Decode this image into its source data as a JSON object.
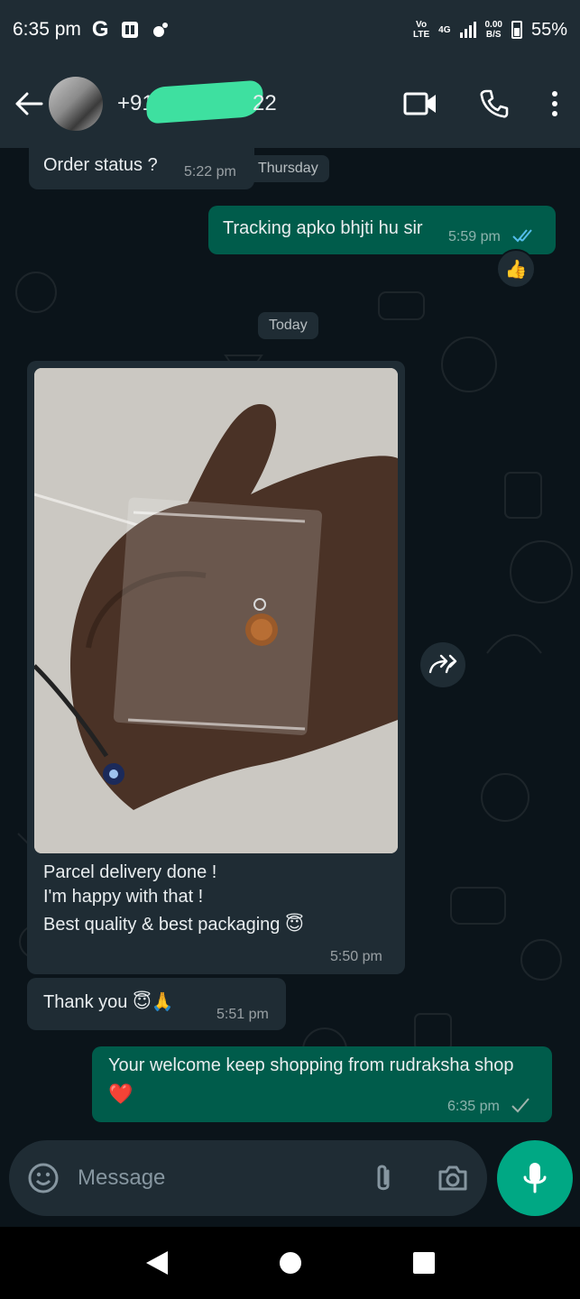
{
  "status_bar": {
    "time": "6:35 pm",
    "network_top": "Vo",
    "network_bottom": "LTE",
    "net_type": "4G",
    "speed_top": "0.00",
    "speed_bottom": "B/S",
    "battery": "55%"
  },
  "header": {
    "contact_prefix": "+91",
    "contact_suffix": "22",
    "icons": [
      "back-arrow-icon",
      "video-call-icon",
      "voice-call-icon",
      "more-options-icon"
    ]
  },
  "messages": [
    {
      "direction": "in",
      "text": "Order status ?",
      "time": "5:22 pm"
    },
    {
      "type": "date",
      "text": "Thursday"
    },
    {
      "direction": "out",
      "text": "Tracking apko bhjti hu sir",
      "time": "5:59 pm",
      "status": "read",
      "reaction": "👍"
    },
    {
      "type": "date",
      "text": "Today"
    },
    {
      "direction": "in",
      "type": "image",
      "line1": "Parcel delivery done !",
      "line2": "I'm happy with that !",
      "line3": "Best quality & best packaging 😇",
      "time": "5:50 pm"
    },
    {
      "direction": "in",
      "text": "Thank you 😇🙏",
      "time": "5:51 pm"
    },
    {
      "direction": "out",
      "text": "Your welcome keep shopping from rudraksha shop",
      "emoji": "❤️",
      "time": "6:35 pm",
      "status": "sent"
    }
  ],
  "composer": {
    "placeholder": "Message",
    "icons": [
      "emoji-icon",
      "attach-icon",
      "camera-icon",
      "mic-icon"
    ]
  },
  "colors": {
    "background": "#0b141a",
    "incoming": "#1f2c34",
    "outgoing": "#005c4b",
    "accent": "#00a884",
    "read_ticks": "#53bdeb"
  }
}
